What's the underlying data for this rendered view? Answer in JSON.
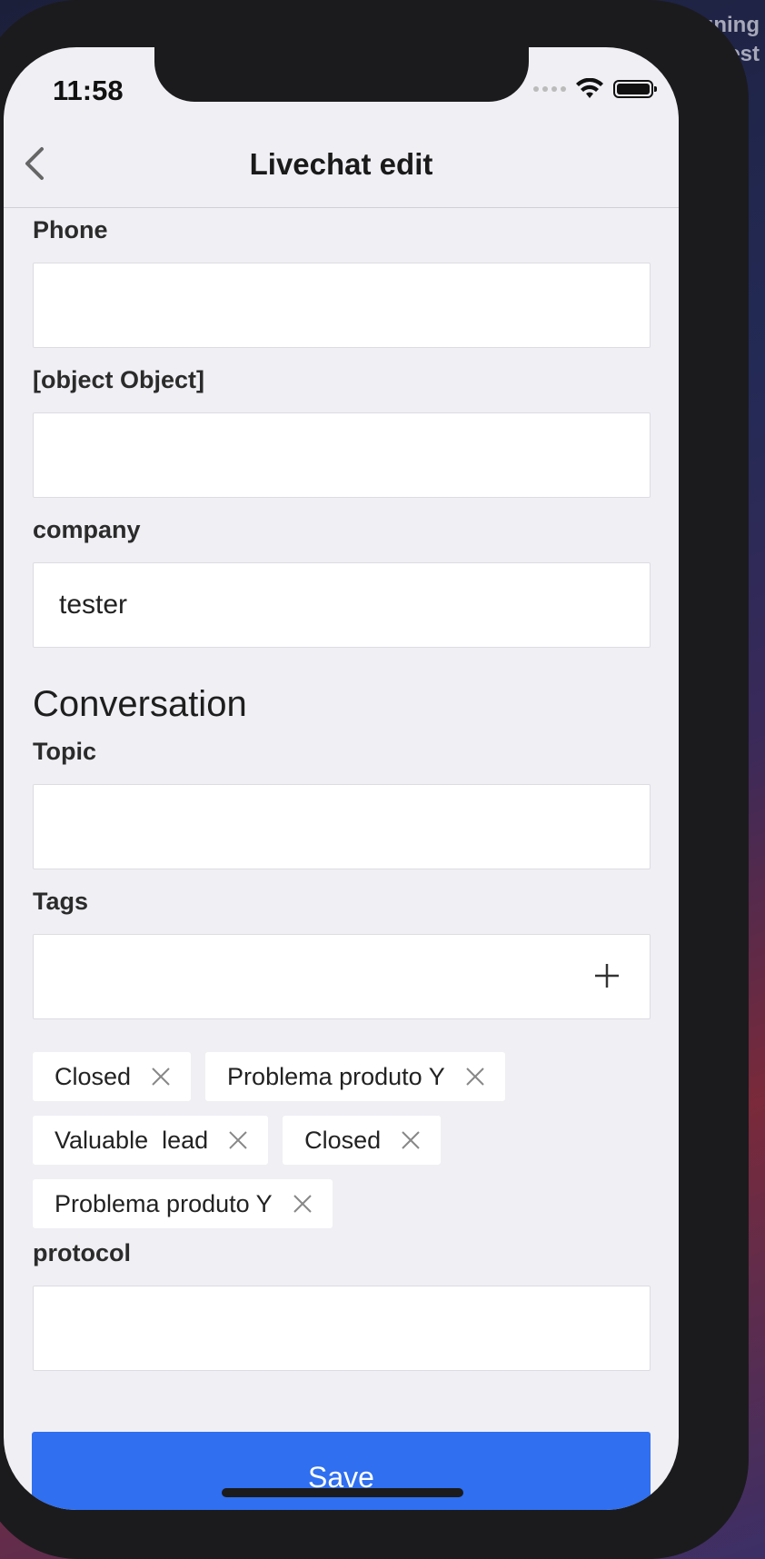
{
  "background": {
    "text_line1": "igning",
    "text_line2": "est"
  },
  "status_bar": {
    "time": "11:58"
  },
  "navbar": {
    "title": "Livechat edit"
  },
  "fields": {
    "phone": {
      "label": "Phone",
      "value": ""
    },
    "object": {
      "label": "[object Object]",
      "value": ""
    },
    "company": {
      "label": "company",
      "value": "tester"
    }
  },
  "conversation": {
    "title": "Conversation",
    "topic": {
      "label": "Topic",
      "value": ""
    },
    "tags": {
      "label": "Tags",
      "items": [
        "Closed",
        "Problema produto Y",
        "Valuable  lead",
        "Closed",
        "Problema produto Y"
      ]
    },
    "protocol": {
      "label": "protocol",
      "value": ""
    }
  },
  "save_label": "Save",
  "colors": {
    "accent": "#2f6ff0",
    "screen_bg": "#efeff4"
  }
}
